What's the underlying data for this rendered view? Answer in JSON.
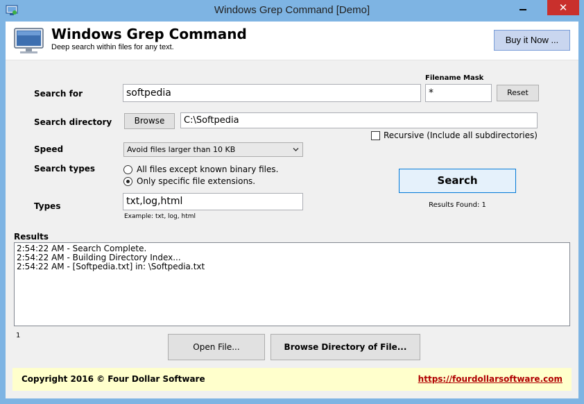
{
  "window": {
    "title": "Windows Grep Command [Demo]",
    "close_glyph": "✕"
  },
  "header": {
    "title": "Windows Grep Command",
    "subtitle": "Deep search within files for any text.",
    "buy_label": "Buy it Now ..."
  },
  "form": {
    "search_for_label": "Search for",
    "search_for_value": "softpedia",
    "filename_mask_label": "Filename Mask",
    "filename_mask_value": "*",
    "reset_label": "Reset",
    "search_directory_label": "Search directory",
    "browse_label": "Browse",
    "directory_value": "C:\\Softpedia",
    "recursive_label": "Recursive (Include all subdirectories)",
    "recursive_checked": false,
    "speed_label": "Speed",
    "speed_value": "Avoid files larger than 10 KB",
    "search_types_label": "Search types",
    "search_type_options": [
      {
        "label": "All files except known binary files.",
        "checked": false
      },
      {
        "label": "Only specific file extensions.",
        "checked": true
      }
    ],
    "types_label": "Types",
    "types_value": "txt,log,html",
    "types_example": "Example: txt, log, html",
    "search_button_label": "Search",
    "results_found": "Results Found: 1"
  },
  "results": {
    "label": "Results",
    "lines": [
      "2:54:22 AM - Search Complete.",
      "2:54:22 AM - Building Directory Index...",
      "2:54:22 AM - [Softpedia.txt]  in: \\Softpedia.txt"
    ],
    "count": "1"
  },
  "actions": {
    "open_file_label": "Open File...",
    "browse_directory_label": "Browse Directory of File..."
  },
  "footer": {
    "copyright": "Copyright 2016 © Four Dollar Software",
    "link": "https://fourdollarsoftware.com"
  },
  "colors": {
    "window_frame": "#7eb4e3",
    "close_button": "#c9302c",
    "buy_button": "#c9d6ef",
    "footer_bg": "#ffffcc",
    "link": "#b00000"
  },
  "icons": [
    "app-icon",
    "monitor-icon",
    "minimize-icon",
    "close-icon",
    "dropdown-arrow-icon"
  ]
}
